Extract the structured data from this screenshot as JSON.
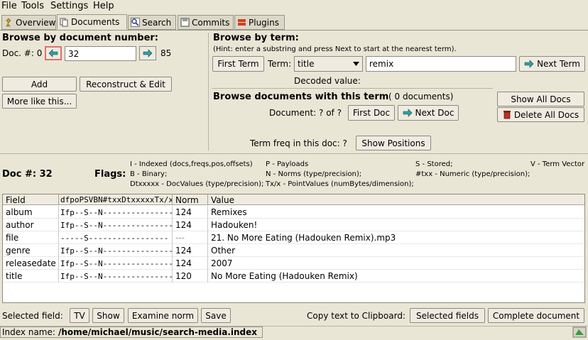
{
  "menu": {
    "file": "File",
    "tools": "Tools",
    "settings": "Settings",
    "help": "Help"
  },
  "tabs": [
    "Overview",
    "Documents",
    "Search",
    "Commits",
    "Plugins"
  ],
  "browse_doc": {
    "title": "Browse by document number:",
    "doc_label": "Doc. #: 0",
    "doc_value": "32",
    "max_doc": "85",
    "add": "Add",
    "reconstruct": "Reconstruct & Edit",
    "more_like": "More like this..."
  },
  "browse_term": {
    "title": "Browse by term:",
    "hint": "(Hint: enter a substring and press Next to start at the nearest term).",
    "first_term": "First Term",
    "term_label": "Term:",
    "field_select": "title",
    "term_value": "remix",
    "next_term": "Next Term",
    "decoded_label": "Decoded value:"
  },
  "browse_docs_term": {
    "title": "Browse documents with this term",
    "count": "( 0 documents)",
    "document_label": "Document: ? of ?",
    "first_doc": "First Doc",
    "next_doc": "Next Doc",
    "show_all": "Show All Docs",
    "delete_all": "Delete All Docs",
    "freq_label": "Term freq in this doc: ?",
    "show_positions": "Show Positions"
  },
  "doc_info": {
    "doc_num": "Doc #: 32",
    "flags_label": "Flags:",
    "legend": [
      "I - Indexed (docs,freqs,pos,offsets)",
      "P - Payloads",
      "S - Stored;",
      "V - Term Vector",
      "B - Binary;",
      "N - Norms (type/precision);",
      "#txx - Numeric (type/precision);",
      "Dtxxxxx - DocValues (type/precision);",
      "Tx/x - PointValues (numBytes/dimension);"
    ]
  },
  "table": {
    "headers": [
      "Field",
      "dfpoPSVBN#txxDtxxxxxTx/x",
      "Norm",
      "Value"
    ],
    "rows": [
      {
        "field": "album",
        "flags": "Ifp--S--N-----------------",
        "norm": "124",
        "value": "Remixes"
      },
      {
        "field": "author",
        "flags": "Ifp--S--N-----------------",
        "norm": "124",
        "value": "Hadouken!"
      },
      {
        "field": "file",
        "flags": "-----S-----------------",
        "norm": "---",
        "value": "21. No More Eating (Hadouken Remix).mp3"
      },
      {
        "field": "genre",
        "flags": "Ifp--S--N-----------------",
        "norm": "124",
        "value": "Other"
      },
      {
        "field": "releasedate",
        "flags": "Ifp--S--N-----------------",
        "norm": "124",
        "value": "2007"
      },
      {
        "field": "title",
        "flags": "Ifp--S--N-----------------",
        "norm": "120",
        "value": "No More Eating (Hadouken Remix)"
      }
    ]
  },
  "bottom": {
    "selected_field": "Selected field:",
    "tv": "TV",
    "show": "Show",
    "examine_norm": "Examine norm",
    "save": "Save",
    "copy_label": "Copy text to Clipboard:",
    "selected_fields": "Selected fields",
    "complete_doc": "Complete document"
  },
  "status": {
    "label": "Index name:",
    "path": "/home/michael/music/search-media.index"
  }
}
